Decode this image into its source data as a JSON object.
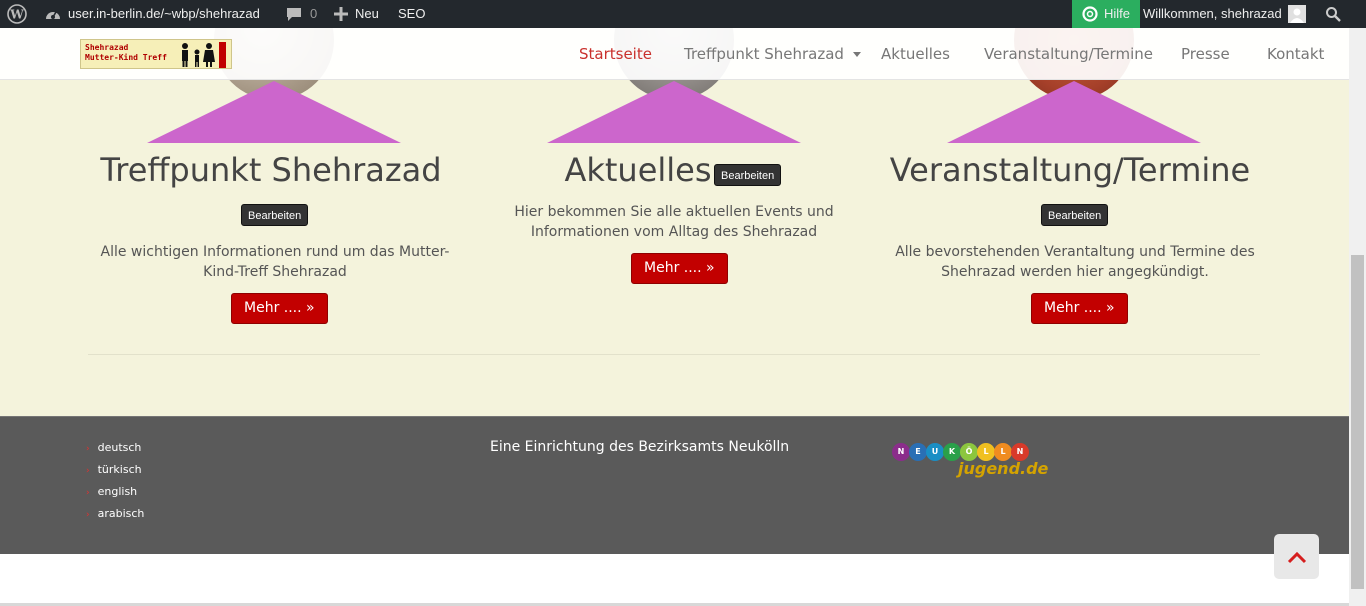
{
  "admin_bar": {
    "site_url": "user.in-berlin.de/~wbp/shehrazad",
    "comments_count": "0",
    "new_label": "Neu",
    "seo_label": "SEO",
    "help_label": "Hilfe",
    "welcome_text": "Willkommen, shehrazad"
  },
  "header": {
    "logo_line1": "Shehrazad",
    "logo_line2": "Mutter-Kind Treff",
    "nav": [
      {
        "label": "Startseite"
      },
      {
        "label": "Treffpunkt Shehrazad"
      },
      {
        "label": "Aktuelles"
      },
      {
        "label": "Veranstaltung/Termine"
      },
      {
        "label": "Presse"
      },
      {
        "label": "Kontakt"
      }
    ]
  },
  "features": [
    {
      "title": "Treffpunkt Shehrazad",
      "edit_label": "Bearbeiten",
      "description_line1": "Alle wichtigen Informationen rund um das Mutter-",
      "description_line2": "Kind-Treff Shehrazad",
      "button_label": "Mehr .... »"
    },
    {
      "title": "Aktuelles",
      "edit_label": "Bearbeiten",
      "description_line1": "Hier bekommen Sie alle aktuellen Events und",
      "description_line2": "Informationen vom Alltag des Shehrazad",
      "button_label": "Mehr .... »"
    },
    {
      "title": "Veranstaltung/Termine",
      "edit_label": "Bearbeiten",
      "description_line1": "Alle bevorstehenden Verantaltung und Termine des",
      "description_line2": "Shehrazad werden hier angegkündigt.",
      "button_label": "Mehr .... »"
    }
  ],
  "footer": {
    "languages": [
      {
        "label": "deutsch"
      },
      {
        "label": "türkisch"
      },
      {
        "label": "english"
      },
      {
        "label": "arabisch"
      }
    ],
    "center_text": "Eine Einrichtung des Bezirksamts Neukölln",
    "partner_logo_letters": [
      "N",
      "E",
      "U",
      "K",
      "Ö",
      "L",
      "L",
      "N"
    ],
    "partner_logo_text": "jugend.de"
  },
  "colors": {
    "accent_red": "#c20000",
    "triangle_purple": "#cc66cc",
    "section_bg": "#f4f3dc",
    "footer_bg": "#5a5a5a",
    "adminbar_bg": "#23282d",
    "help_green": "#2bae5f"
  },
  "icons": {
    "wordpress": "wordpress-logo-icon",
    "dashboard": "dashboard-gauge-icon",
    "comments": "comment-bubble-icon",
    "new": "plus-icon",
    "help": "lifebuoy-icon",
    "user": "user-avatar-icon",
    "search": "search-icon",
    "dropdown": "caret-down-icon",
    "scroll_top": "chevron-up-icon"
  }
}
